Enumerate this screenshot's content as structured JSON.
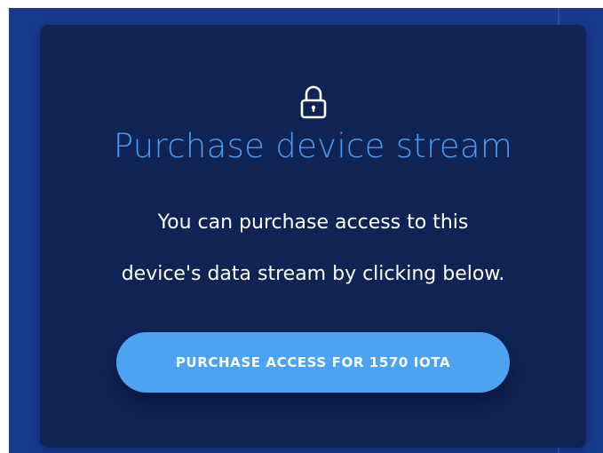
{
  "purchase_card": {
    "icon": "lock-icon",
    "title": "Purchase device stream",
    "description_lines": [
      "You can purchase access to this",
      "device's data stream by clicking below."
    ],
    "button_label": "PURCHASE ACCESS FOR 1570 IOTA"
  },
  "colors": {
    "background": "#173a8e",
    "card": "#0f2355",
    "title": "#4c9bf0",
    "button": "#4da2f2",
    "text": "#ffffff"
  }
}
